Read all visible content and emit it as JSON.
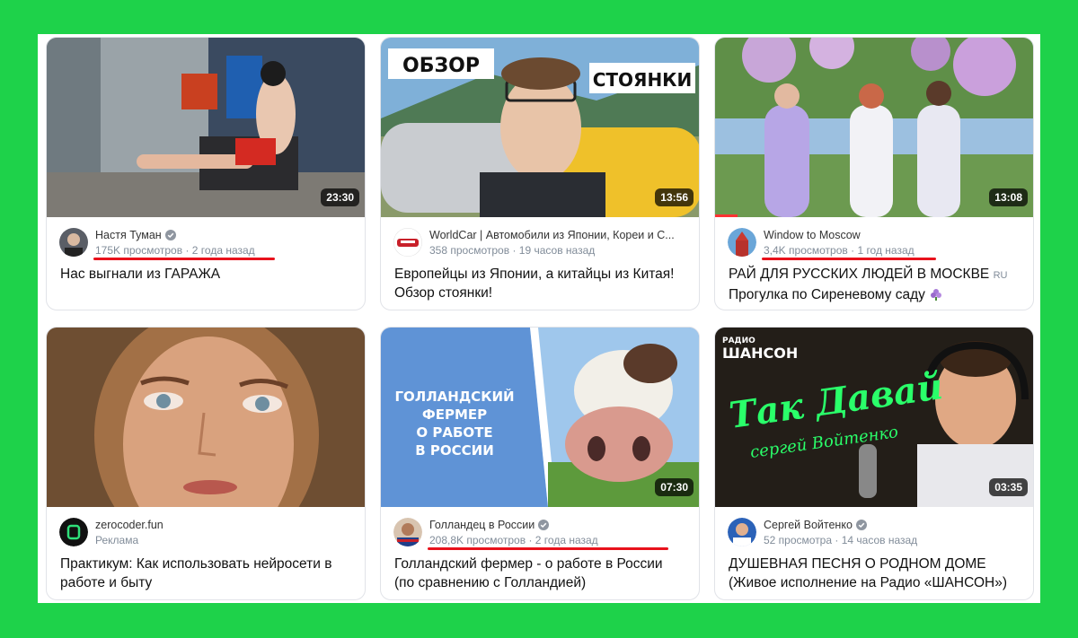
{
  "colors": {
    "frame_bg": "#1ed24a",
    "underline": "#e8121c",
    "verified": "#8f96a0"
  },
  "cards": [
    {
      "duration": "23:30",
      "channel": "Настя Туман",
      "verified": true,
      "views": "175K просмотров",
      "sep": "·",
      "age": "2 года назад",
      "title": "Нас выгнали из ГАРАЖА",
      "title_badge": ""
    },
    {
      "duration": "13:56",
      "channel": "WorldCar | Автомобили из Японии, Кореи и С...",
      "verified": false,
      "views": "358 просмотров",
      "sep": "·",
      "age": "19 часов назад",
      "title": "Европейцы из Японии, а китайцы из Китая! Обзор стоянки!",
      "title_badge": "",
      "thumb_text": {
        "left": "ОБЗОР",
        "right": "СТОЯНКИ"
      }
    },
    {
      "duration": "13:08",
      "channel": "Window to Moscow",
      "verified": false,
      "views": "3,4K просмотров",
      "sep": "·",
      "age": "1 год назад",
      "title_line1": "РАЙ ДЛЯ РУССКИХ ЛЮДЕЙ В МОСКВЕ",
      "title_badge": "RU",
      "title_line2": "Прогулка по Сиреневому саду",
      "progress": 0.07
    },
    {
      "duration": "",
      "channel": "zerocoder.fun",
      "verified": false,
      "views": "Реклама",
      "sep": "",
      "age": "",
      "title": "Практикум: Как использовать нейросети в работе и быту",
      "title_badge": ""
    },
    {
      "duration": "07:30",
      "channel": "Голландец в России",
      "verified": true,
      "views": "208,8K просмотров",
      "sep": "·",
      "age": "2 года назад",
      "title": "Голландский фермер - о работе в России (по сравнению с Голландией)",
      "title_badge": "",
      "thumb_text": {
        "l1": "ГОЛЛАНДСКИЙ",
        "l2": "ФЕРМЕР",
        "l3": "О РАБОТЕ",
        "l4": "В РОССИИ"
      }
    },
    {
      "duration": "03:35",
      "channel": "Сергей Войтенко",
      "verified": true,
      "views": "52 просмотра",
      "sep": "·",
      "age": "14 часов назад",
      "title": "ДУШЕВНАЯ ПЕСНЯ О РОДНОМ ДОМЕ (Живое исполнение на Радио «ШАНСОН»)",
      "title_badge": "",
      "thumb_text": {
        "radio": "РАДИО",
        "station": "ШАНСОН",
        "neon1": "Так Давай",
        "neon2": "сергей Войтенко"
      }
    }
  ]
}
